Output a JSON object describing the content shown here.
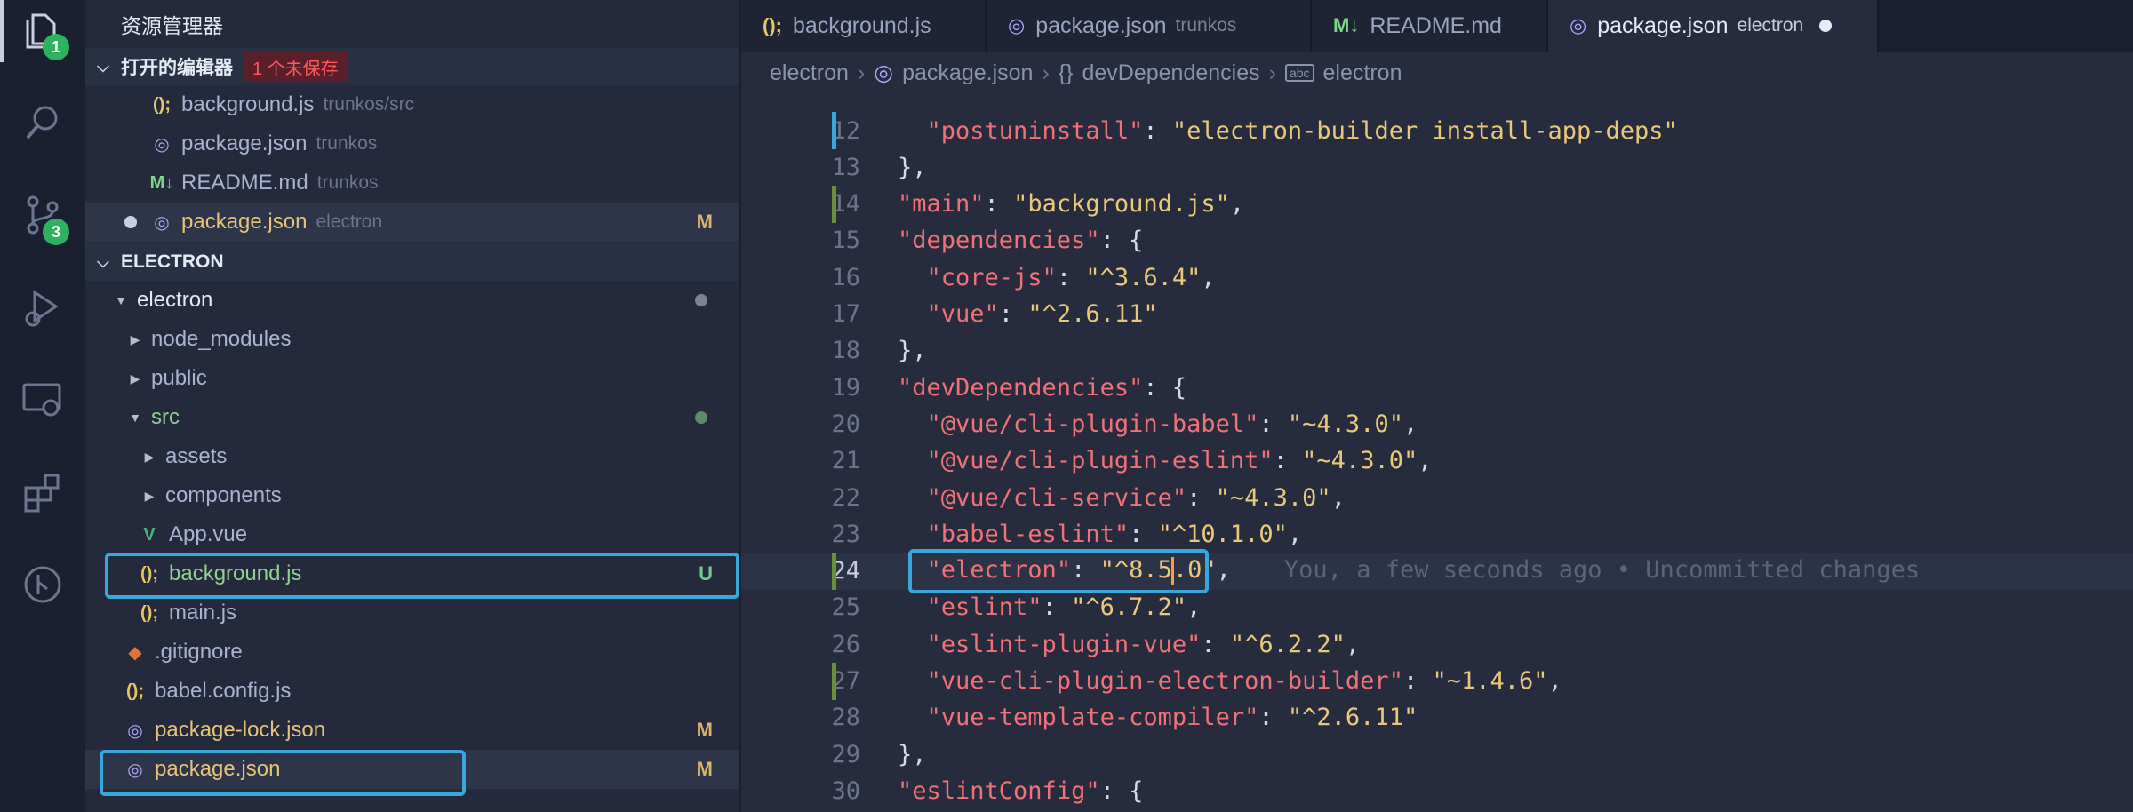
{
  "activity_bar": {
    "items": [
      {
        "name": "explorer-icon",
        "badge": "1"
      },
      {
        "name": "search-icon",
        "badge": ""
      },
      {
        "name": "source-control-icon",
        "badge": "3"
      },
      {
        "name": "run-debug-icon",
        "badge": ""
      },
      {
        "name": "remote-explorer-icon",
        "badge": ""
      },
      {
        "name": "extensions-icon",
        "badge": ""
      },
      {
        "name": "git-graph-icon",
        "badge": ""
      }
    ]
  },
  "sidebar": {
    "title": "资源管理器",
    "open_editors": {
      "label": "打开的编辑器",
      "badge": "1 个未保存",
      "items": [
        {
          "icon": "();",
          "name": "background.js",
          "desc": "trunkos/src"
        },
        {
          "icon": "json-icon",
          "name": "package.json",
          "desc": "trunkos"
        },
        {
          "icon": "M↓",
          "name": "README.md",
          "desc": "trunkos"
        },
        {
          "icon": "json-icon",
          "name": "package.json",
          "desc": "electron",
          "status": "M"
        }
      ]
    },
    "project": {
      "label": "ELECTRON",
      "tree": [
        {
          "name": "electron",
          "type": "folder-open"
        },
        {
          "name": "node_modules",
          "type": "folder"
        },
        {
          "name": "public",
          "type": "folder"
        },
        {
          "name": "src",
          "type": "folder-open"
        },
        {
          "name": "assets",
          "type": "folder"
        },
        {
          "name": "components",
          "type": "folder"
        },
        {
          "name": "App.vue",
          "icon": "V"
        },
        {
          "name": "background.js",
          "icon": "();",
          "status": "U"
        },
        {
          "name": "main.js",
          "icon": "();"
        },
        {
          "name": ".gitignore",
          "icon": "◆"
        },
        {
          "name": "babel.config.js",
          "icon": "();"
        },
        {
          "name": "package-lock.json",
          "icon": "json-icon",
          "status": "M"
        },
        {
          "name": "package.json",
          "icon": "json-icon",
          "status": "M"
        }
      ]
    }
  },
  "tabs": [
    {
      "icon": "();",
      "label": "background.js",
      "desc": ""
    },
    {
      "icon": "json-icon",
      "label": "package.json",
      "desc": "trunkos"
    },
    {
      "icon": "M↓",
      "label": "README.md",
      "desc": ""
    },
    {
      "icon": "json-icon",
      "label": "package.json",
      "desc": "electron"
    }
  ],
  "breadcrumb": {
    "folder": "electron",
    "file": "package.json",
    "object": "devDependencies",
    "key": "electron",
    "object_icon": "{}",
    "key_icon": "abc"
  },
  "editor": {
    "lines": [
      {
        "n": "12",
        "text": "  \"postuninstall\": \"electron-builder install-app-deps\""
      },
      {
        "n": "13",
        "text": "},"
      },
      {
        "n": "14",
        "text": "\"main\": \"background.js\","
      },
      {
        "n": "15",
        "text": "\"dependencies\": {"
      },
      {
        "n": "16",
        "text": "  \"core-js\": \"^3.6.4\","
      },
      {
        "n": "17",
        "text": "  \"vue\": \"^2.6.11\""
      },
      {
        "n": "18",
        "text": "},"
      },
      {
        "n": "19",
        "text": "\"devDependencies\": {"
      },
      {
        "n": "20",
        "text": "  \"@vue/cli-plugin-babel\": \"~4.3.0\","
      },
      {
        "n": "21",
        "text": "  \"@vue/cli-plugin-eslint\": \"~4.3.0\","
      },
      {
        "n": "22",
        "text": "  \"@vue/cli-service\": \"~4.3.0\","
      },
      {
        "n": "23",
        "text": "  \"babel-eslint\": \"^10.1.0\","
      },
      {
        "n": "24",
        "text": "  \"electron\": \"^8.5.0\","
      },
      {
        "n": "25",
        "text": "  \"eslint\": \"^6.7.2\","
      },
      {
        "n": "26",
        "text": "  \"eslint-plugin-vue\": \"^6.2.2\","
      },
      {
        "n": "27",
        "text": "  \"vue-cli-plugin-electron-builder\": \"~1.4.6\","
      },
      {
        "n": "28",
        "text": "  \"vue-template-compiler\": \"^2.6.11\""
      },
      {
        "n": "29",
        "text": "},"
      },
      {
        "n": "30",
        "text": "\"eslintConfig\": {"
      }
    ],
    "blame": "You, a few seconds ago • Uncommitted changes"
  },
  "colors": {
    "accent_highlight": "#3aa7dc",
    "badge_green": "#2fb25f",
    "string": "#e9c87a",
    "key": "#f07178"
  }
}
